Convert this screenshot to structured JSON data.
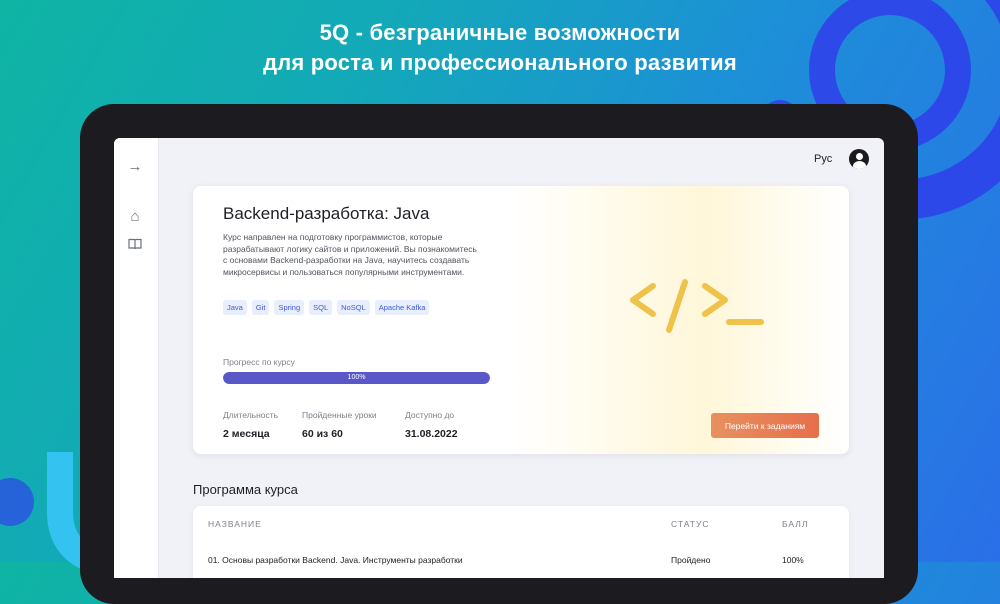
{
  "promo": {
    "line1": "5Q - безграничные возможности",
    "line2": "для роста и профессионального развития"
  },
  "colors": {
    "brand_blue": "#2f43e8",
    "accent_purple": "#5a58c9",
    "cta_orange": "#e76f4b",
    "tag_blue": "#3b5bd6"
  },
  "topbar": {
    "language": "Рус",
    "avatar_icon": "user-icon"
  },
  "sidebar": {
    "items": [
      {
        "icon": "arrow-right-icon",
        "glyph": "→"
      },
      {
        "icon": "home-icon",
        "glyph": "⌂"
      },
      {
        "icon": "book-icon",
        "glyph": "▯"
      }
    ]
  },
  "course": {
    "title": "Backend-разработка: Java",
    "description": "Курс направлен на подготовку программистов, которые разрабатывают логику сайтов и приложений. Вы познакомитесь с основами Backend-разработки на Java, научитесь создавать микросервисы и пользоваться популярными инструментами.",
    "tags": [
      "Java",
      "Git",
      "Spring",
      "SQL",
      "NoSQL",
      "Apache Kafka"
    ],
    "progress_label": "Прогресс по курсу",
    "progress_text": "100%",
    "progress_fraction": 1.0,
    "stats": [
      {
        "label": "Длительность",
        "value": "2 месяца"
      },
      {
        "label": "Пройденные уроки",
        "value": "60 из 60"
      },
      {
        "label": "Доступно до",
        "value": "31.08.2022"
      }
    ],
    "cta_label": "Перейти к заданиям",
    "art_icon": "code-brackets-icon"
  },
  "program": {
    "title": "Программа курса",
    "headers": [
      "НАЗВАНИЕ",
      "СТАТУС",
      "БАЛЛ"
    ],
    "rows": [
      {
        "name": "01. Основы разработки Backend. Java. Инструменты разработки",
        "status": "Пройдено",
        "score": "100%"
      }
    ]
  }
}
